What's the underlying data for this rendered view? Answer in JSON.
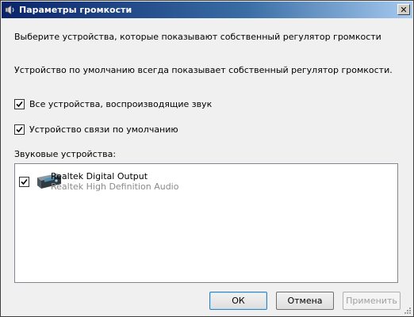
{
  "window": {
    "title": "Параметры громкости"
  },
  "intro_text": "Выберите устройства, которые показывают собственный регулятор громкости",
  "default_text": "Устройство по умолчанию всегда показывает собственный регулятор громкости.",
  "options": {
    "all_devices_label": "Все устройства, воспроизводящие звук",
    "all_devices_checked": true,
    "comm_device_label": "Устройство связи по умолчанию",
    "comm_device_checked": true
  },
  "devices_label": "Звуковые устройства:",
  "devices": [
    {
      "name": "Realtek Digital Output",
      "description": "Realtek High Definition Audio",
      "checked": true,
      "icon": "audio-device-icon"
    }
  ],
  "buttons": {
    "ok": "ОК",
    "cancel": "Отмена",
    "apply": "Применить"
  },
  "icons": {
    "title": "speaker-icon",
    "close": "close-icon"
  },
  "colors": {
    "title_bar": "#0a246a",
    "disabled_text": "#a0a0a0",
    "secondary_text": "#8a8a8a"
  }
}
